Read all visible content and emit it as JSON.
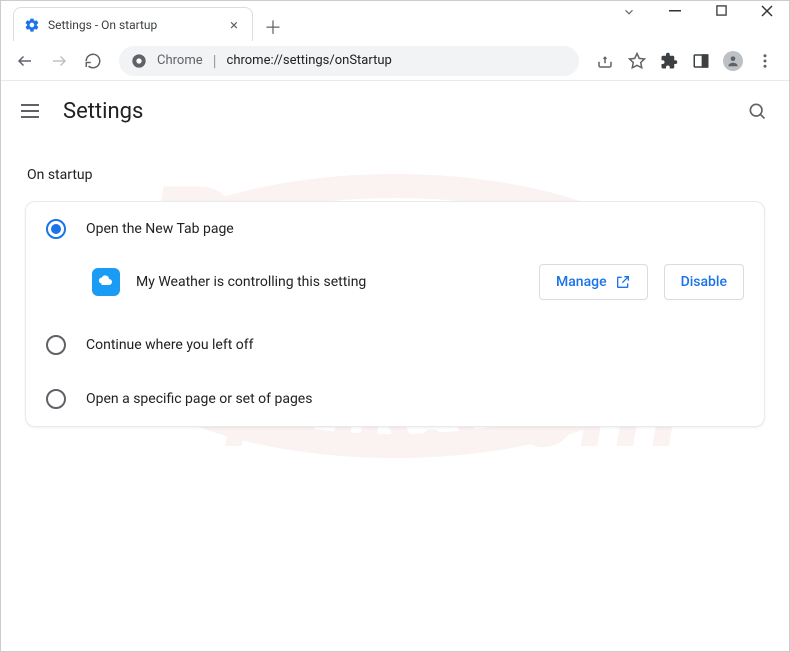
{
  "window": {
    "tab_title": "Settings - On startup"
  },
  "omnibox": {
    "scheme_label": "Chrome",
    "url": "chrome://settings/onStartup"
  },
  "header": {
    "title": "Settings"
  },
  "section": {
    "title": "On startup"
  },
  "options": {
    "new_tab": "Open the New Tab page",
    "continue": "Continue where you left off",
    "specific": "Open a specific page or set of pages"
  },
  "extension_notice": {
    "name": "My Weather",
    "text": "My Weather is controlling this setting",
    "manage_label": "Manage",
    "disable_label": "Disable"
  }
}
